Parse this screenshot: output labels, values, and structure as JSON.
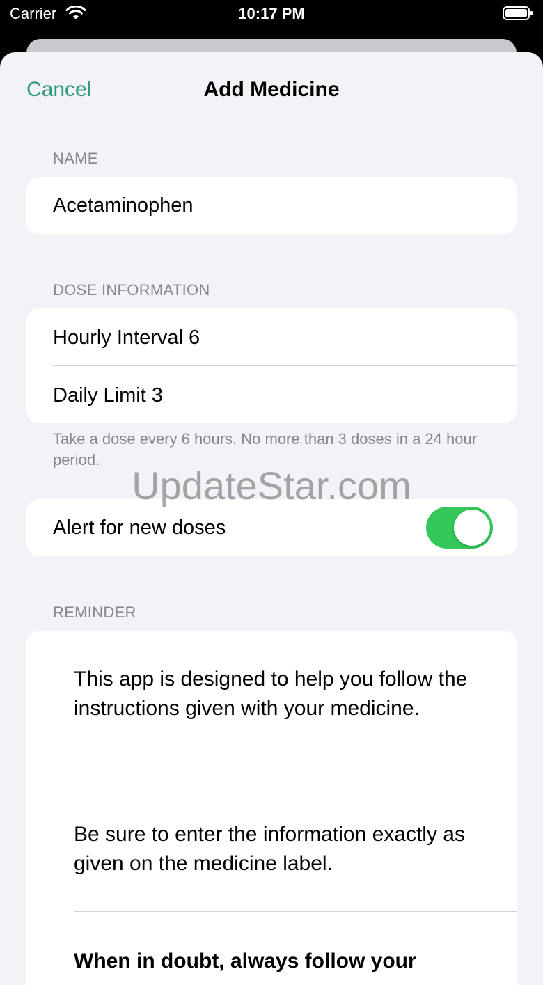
{
  "status_bar": {
    "carrier": "Carrier",
    "time": "10:17 PM",
    "wifi_icon": "wifi-icon",
    "battery_icon": "battery-icon"
  },
  "nav": {
    "cancel_label": "Cancel",
    "title": "Add Medicine"
  },
  "name_section": {
    "header": "NAME",
    "value": "Acetaminophen"
  },
  "dose_section": {
    "header": "DOSE INFORMATION",
    "hourly_interval": "Hourly Interval  6",
    "daily_limit": "Daily Limit  3",
    "footer": "Take a dose every 6 hours. No more than 3 doses in a 24 hour period."
  },
  "alert": {
    "label": "Alert for new doses",
    "enabled": true,
    "toggle_color": "#34c759"
  },
  "reminder_section": {
    "header": "REMINDER",
    "items": [
      "This app is designed to help you follow the instructions given with your medicine.",
      "Be sure to enter the information exactly as given on the medicine label.",
      "When in doubt, always follow your"
    ]
  },
  "watermark": "UpdateStar.com",
  "colors": {
    "accent": "#2f9b7c",
    "background": "#f2f2f7",
    "secondary_text": "#86868b"
  }
}
